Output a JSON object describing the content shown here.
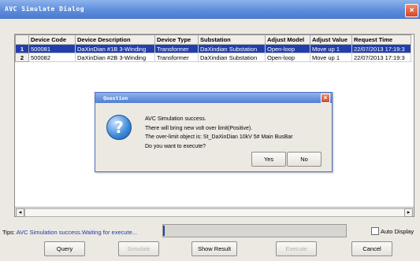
{
  "window": {
    "title": "AVC Simulate Dialog"
  },
  "grid": {
    "columns": [
      "Device Code",
      "Device Description",
      "Device Type",
      "Substation",
      "Adjust Model",
      "Adjust Value",
      "Request Time"
    ],
    "rows": [
      {
        "num": "1",
        "cells": [
          "500081",
          "DaXinDian #1B 3-Winding",
          "Transformer",
          "DaXindian Substation",
          "Open-loop",
          "Move up 1",
          "22/07/2013 17:19:3"
        ]
      },
      {
        "num": "2",
        "cells": [
          "500082",
          "DaXinDian #2B 3-Winding",
          "Transformer",
          "DaXindian Substation",
          "Open-loop",
          "Move up 1",
          "22/07/2013 17:19:3"
        ]
      }
    ]
  },
  "dialog": {
    "title": "Question",
    "lines": [
      "AVC Simulation success.",
      "There will bring new volt over limit(Positive).",
      "The over-limit object is: St_DaXinDian 10kV 5# Main BusBar",
      "Do you want to execute?"
    ],
    "yes": "Yes",
    "no": "No"
  },
  "status": {
    "label": "Tips:",
    "text": "AVC Simulation success.Waiting for execute...",
    "auto_display": "Auto Display"
  },
  "buttons": {
    "query": "Query",
    "simulate": "Simulate",
    "show_result": "Show Result",
    "execute": "Execute",
    "cancel": "Cancel"
  }
}
